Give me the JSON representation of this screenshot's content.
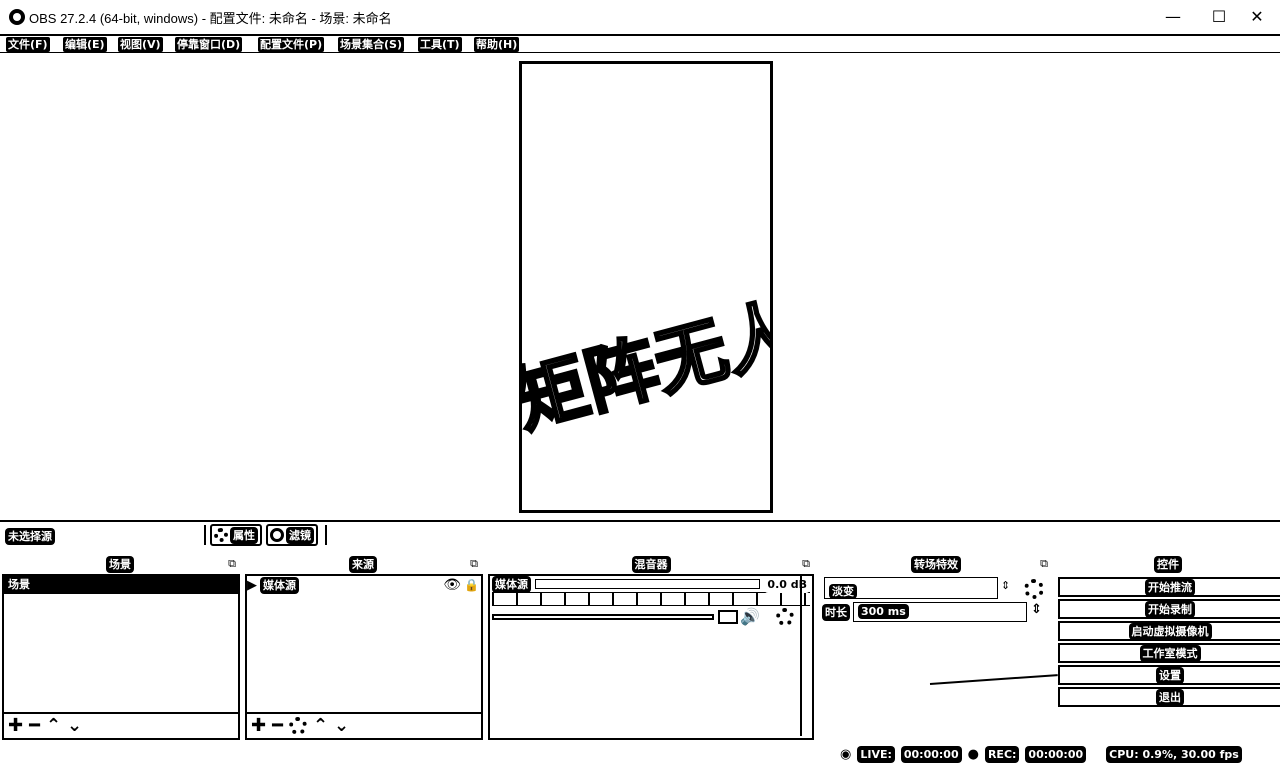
{
  "window": {
    "title": "OBS 27.2.4 (64-bit, windows) - 配置文件: 未命名 - 场景: 未命名",
    "minimize": "—",
    "maximize": "☐",
    "close": "✕"
  },
  "menu": [
    "文件(F)",
    "编辑(E)",
    "视图(V)",
    "停靠窗口(D)",
    "配置文件(P)",
    "场景集合(S)",
    "工具(T)",
    "帮助(H)"
  ],
  "preview": {
    "overlay_text": "矩阵无人"
  },
  "source_toolbar": {
    "no_source_selected": "未选择源",
    "properties": "属性",
    "filters": "滤镜"
  },
  "docks": {
    "scenes": {
      "title": "场景",
      "items": [
        "场景"
      ]
    },
    "sources": {
      "title": "来源",
      "items": [
        "媒体源"
      ]
    },
    "mixer": {
      "title": "混音器",
      "channel": "媒体源",
      "level": "0.0 dB"
    },
    "transitions": {
      "title": "转场特效",
      "type": "淡变",
      "duration_label": "时长",
      "duration_value": "300 ms"
    },
    "controls": {
      "title": "控件",
      "buttons": [
        "开始推流",
        "开始录制",
        "启动虚拟摄像机",
        "工作室模式",
        "设置",
        "退出"
      ]
    }
  },
  "status": {
    "live_label": "LIVE:",
    "live_time": "00:00:00",
    "rec_label": "REC:",
    "rec_time": "00:00:00",
    "cpu": "CPU: 0.9%, 30.00 fps"
  }
}
